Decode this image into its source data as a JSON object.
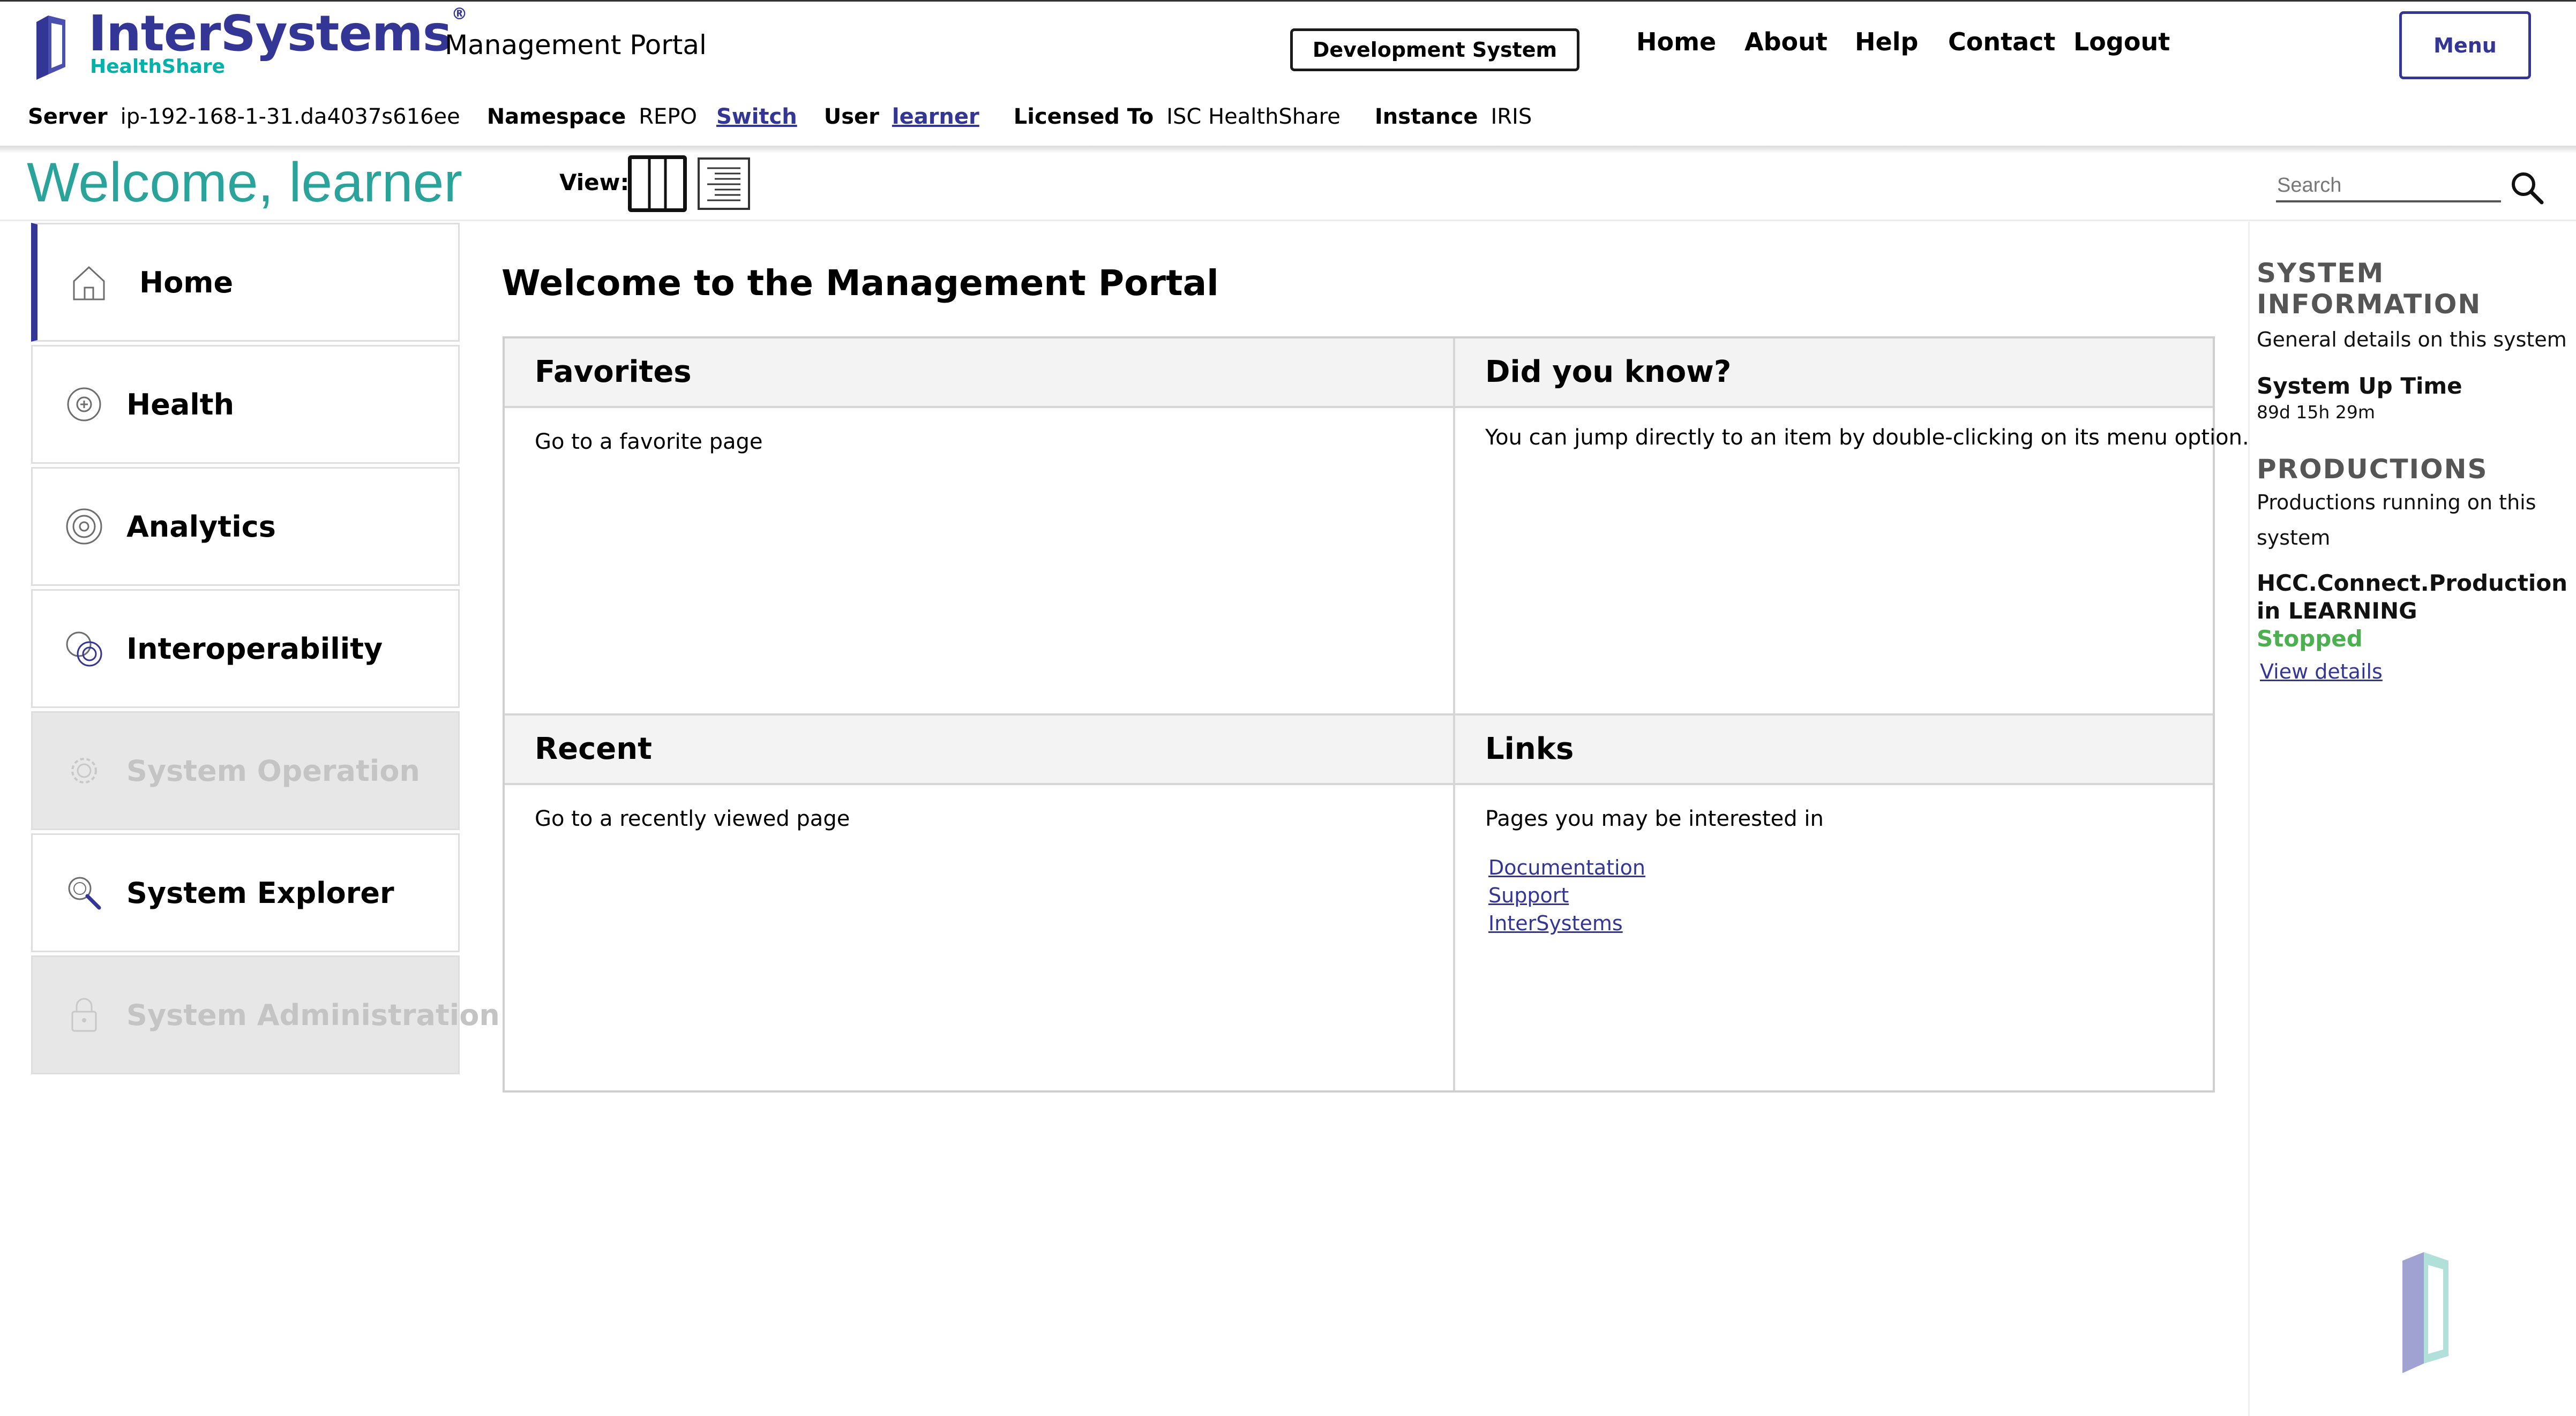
{
  "header": {
    "logo": {
      "brand": "InterSystems",
      "registered": "®",
      "sub_brand": "HealthShare"
    },
    "portal_title": "Management Portal",
    "system_badge": "Development System",
    "nav": [
      "Home",
      "About",
      "Help",
      "Contact",
      "Logout"
    ],
    "menu_label": "Menu",
    "info": {
      "server_label": "Server",
      "server_value": "ip-192-168-1-31.da4037s616ee",
      "namespace_label": "Namespace",
      "namespace_value": "REPO",
      "switch_link": "Switch",
      "user_label": "User",
      "user_value": "learner",
      "licensed_label": "Licensed To",
      "licensed_value": "ISC HealthShare",
      "instance_label": "Instance",
      "instance_value": "IRIS"
    }
  },
  "welcome": {
    "text": "Welcome, learner",
    "view_label": "View:",
    "search_placeholder": "Search"
  },
  "sidebar": {
    "items": [
      {
        "label": "Home",
        "icon": "home-icon",
        "state": "active"
      },
      {
        "label": "Health",
        "icon": "health-icon",
        "state": "enabled"
      },
      {
        "label": "Analytics",
        "icon": "analytics-icon",
        "state": "enabled"
      },
      {
        "label": "Interoperability",
        "icon": "interoperability-icon",
        "state": "enabled"
      },
      {
        "label": "System Operation",
        "icon": "gear-icon",
        "state": "disabled"
      },
      {
        "label": "System Explorer",
        "icon": "magnifier-icon",
        "state": "enabled"
      },
      {
        "label": "System Administration",
        "icon": "lock-icon",
        "state": "disabled"
      }
    ]
  },
  "main": {
    "title": "Welcome to the Management Portal",
    "panels": {
      "favorites": {
        "title": "Favorites",
        "text": "Go to a favorite page"
      },
      "did_you_know": {
        "title": "Did you know?",
        "text": "You can jump directly to an item by double-clicking on its menu option."
      },
      "recent": {
        "title": "Recent",
        "text": "Go to a recently viewed page"
      },
      "links": {
        "title": "Links",
        "text": "Pages you may be interested in",
        "items": [
          "Documentation",
          "Support",
          "InterSystems"
        ]
      }
    }
  },
  "right_panel": {
    "system_info_heading_1": "SYSTEM",
    "system_info_heading_2": "INFORMATION",
    "system_info_desc": "General details on this system",
    "uptime_label": "System Up Time",
    "uptime_value": "89d 15h 29m",
    "productions_heading": "PRODUCTIONS",
    "productions_desc_1": "Productions running on this",
    "productions_desc_2": "system",
    "production_name": "HCC.Connect.Production",
    "production_namespace": "in LEARNING",
    "production_status": "Stopped",
    "view_details": "View details"
  },
  "colors": {
    "brand_purple": "#333695",
    "brand_teal": "#00b2a9",
    "welcome_teal": "#2aa39a",
    "status_green": "#4caf50",
    "disabled_gray": "#e7e7e7"
  }
}
